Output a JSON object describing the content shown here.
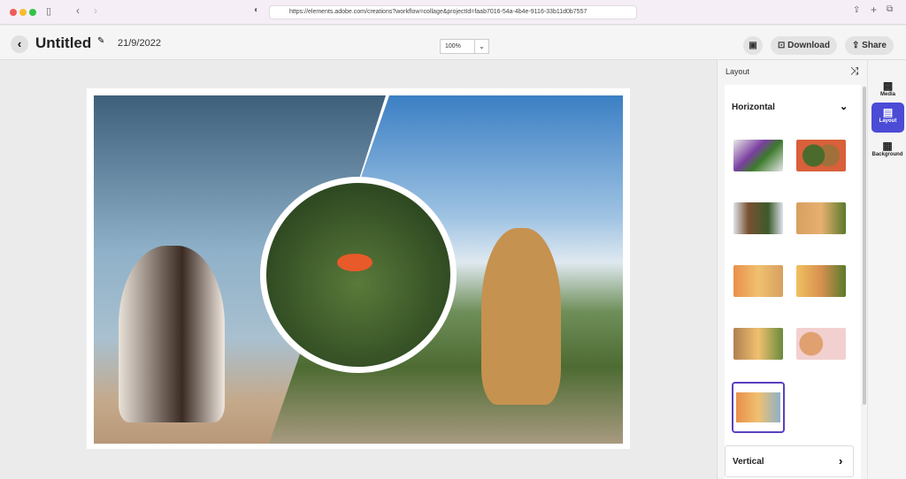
{
  "browser": {
    "url": "https://elements.adobe.com/creations?workflow=collage&projectId=faab7016-54a-4b4e-9116-33b11d0b7557"
  },
  "header": {
    "title": "Untitled",
    "date": "21/9/2022",
    "zoom": "100%",
    "download": "Download",
    "share": "Share"
  },
  "panel": {
    "title": "Layout",
    "section": "Horizontal",
    "section2": "Vertical",
    "selected_index": 8,
    "layout_count": 9
  },
  "rail": {
    "items": [
      {
        "label": "Media"
      },
      {
        "label": "Layout",
        "active": true
      },
      {
        "label": "Background"
      }
    ]
  },
  "colors": {
    "accent": "#4b4bd6"
  }
}
